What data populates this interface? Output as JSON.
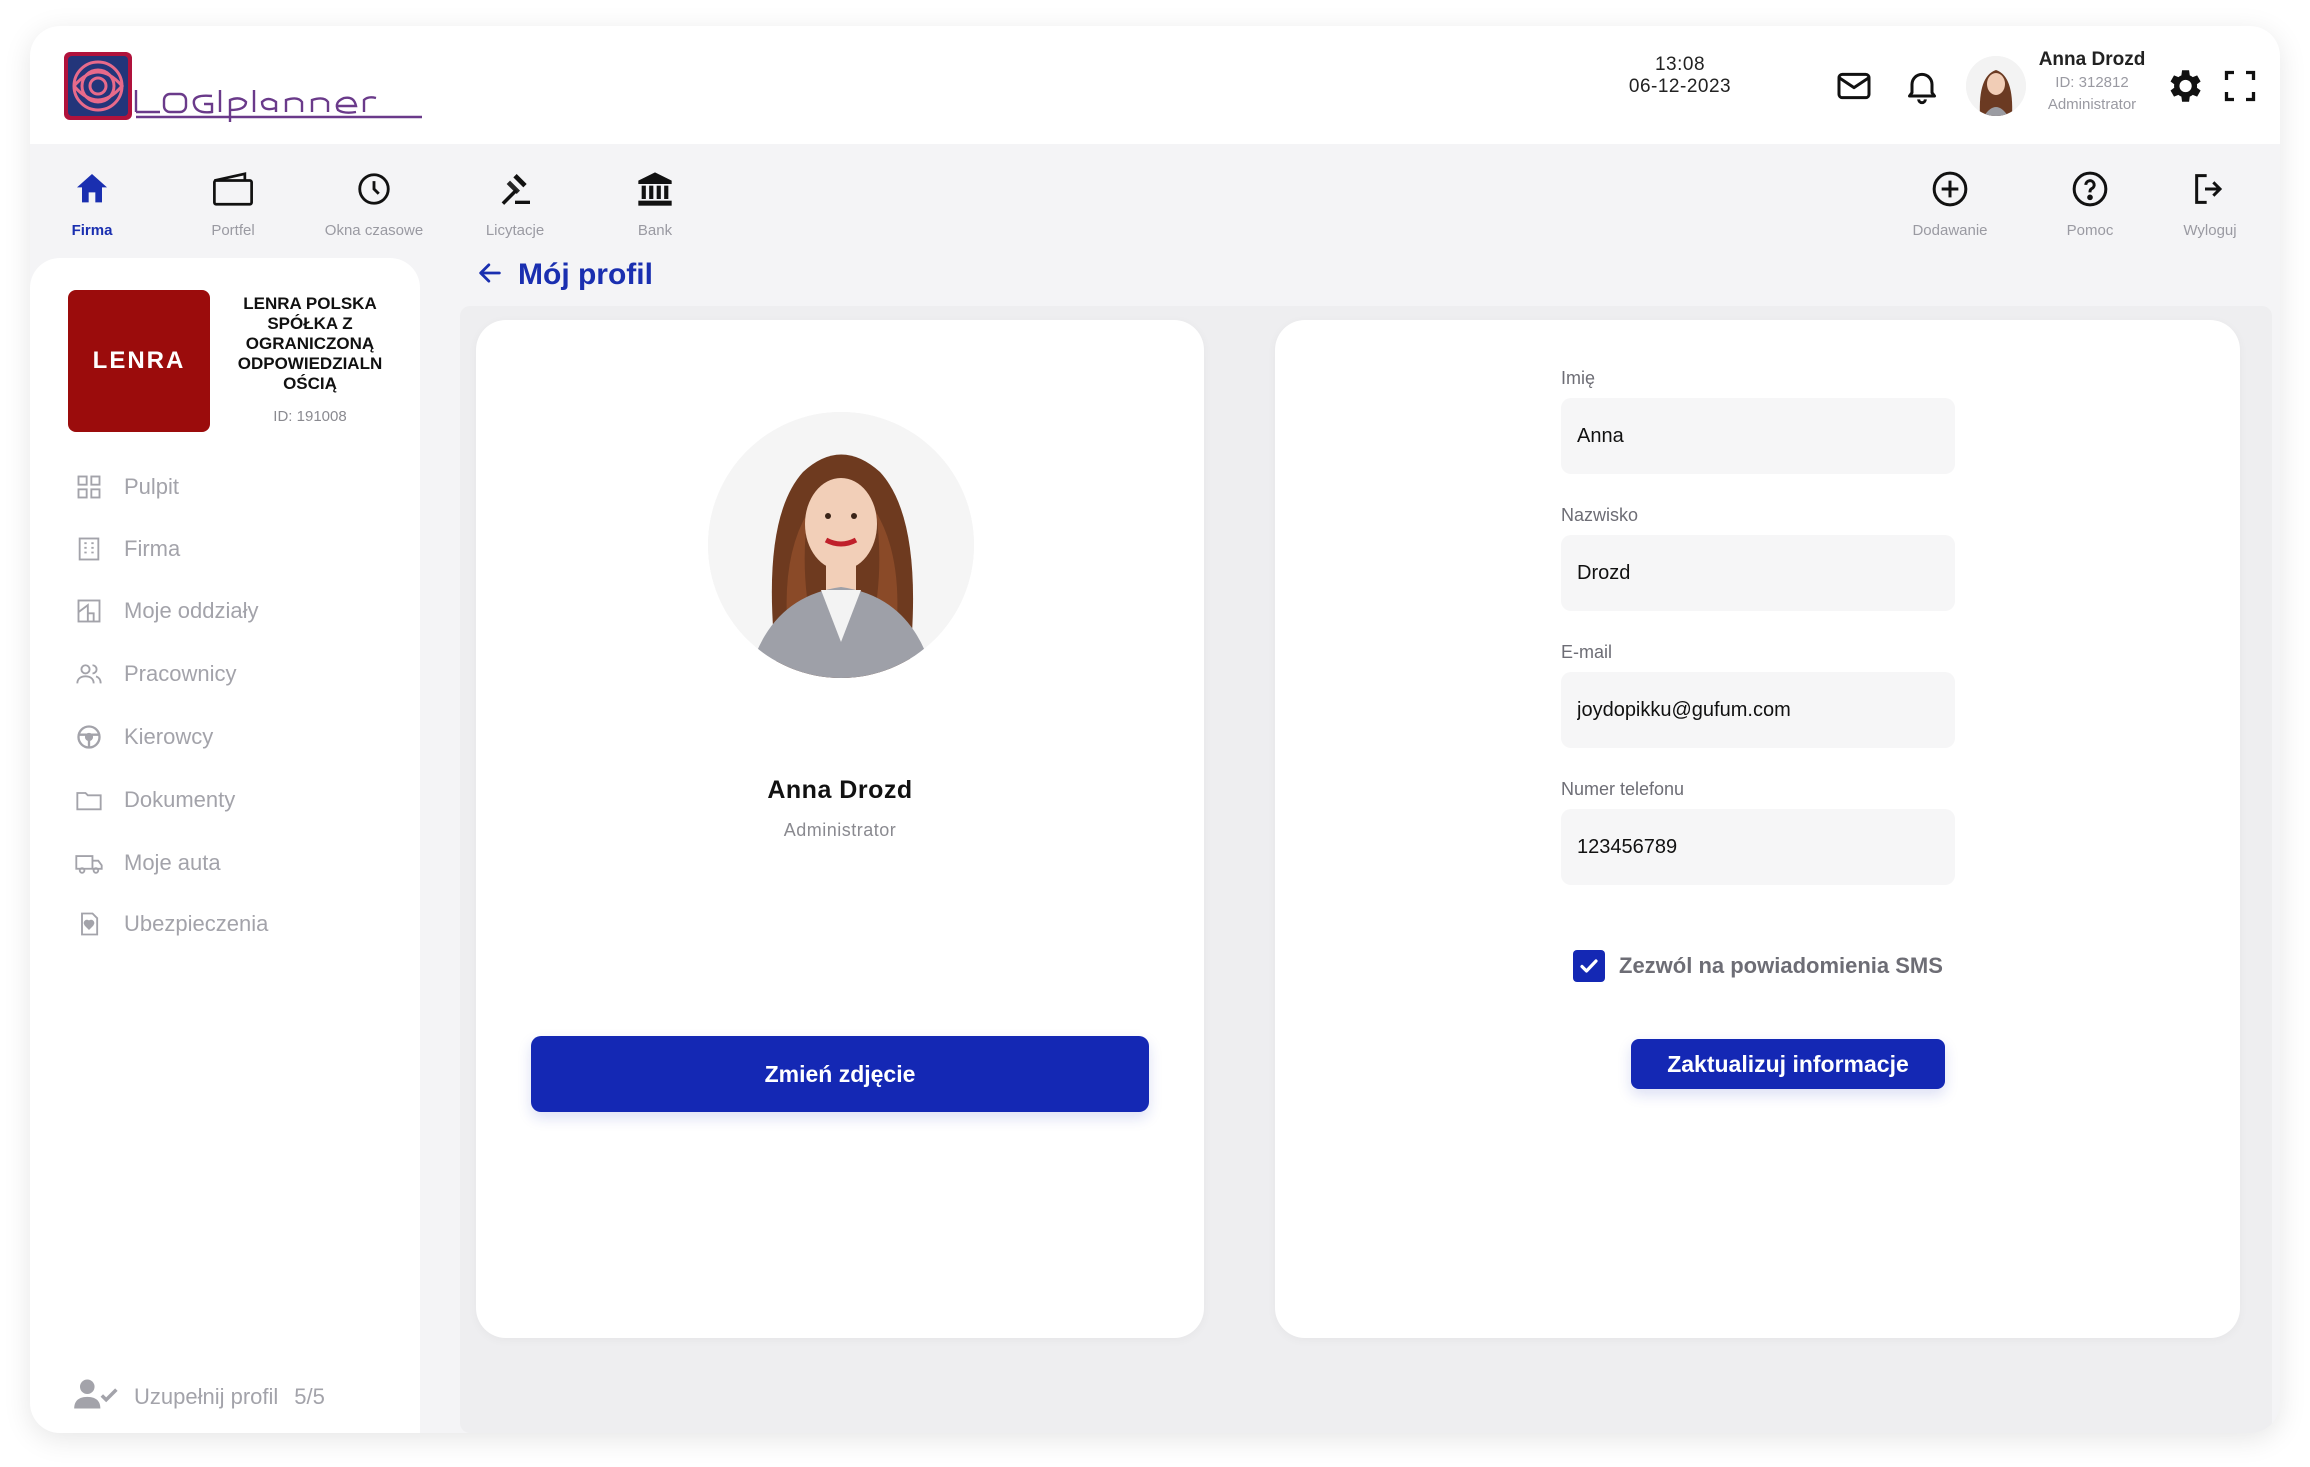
{
  "header": {
    "app_name": "LOGIplanner",
    "time": "13:08",
    "date": "06-12-2023",
    "user": {
      "name": "Anna Drozd",
      "id": "ID: 312812",
      "role": "Administrator"
    }
  },
  "toolbar": {
    "items": [
      {
        "label": "Firma",
        "icon": "home-icon",
        "active": true
      },
      {
        "label": "Portfel",
        "icon": "wallet-icon"
      },
      {
        "label": "Okna czasowe",
        "icon": "clock-icon"
      },
      {
        "label": "Licytacje",
        "icon": "gavel-icon"
      },
      {
        "label": "Bank",
        "icon": "bank-icon"
      }
    ],
    "right_items": [
      {
        "label": "Dodawanie",
        "icon": "plus-circle-icon"
      },
      {
        "label": "Pomoc",
        "icon": "help-circle-icon"
      },
      {
        "label": "Wyloguj",
        "icon": "logout-icon"
      }
    ]
  },
  "sidebar": {
    "company": {
      "logo_text": "LENRA",
      "name": "LENRA POLSKA SPÓŁKA Z OGRANICZONĄ ODPOWIEDZIALN OŚCIĄ",
      "id": "ID: 191008"
    },
    "items": [
      {
        "label": "Pulpit",
        "icon": "grid-icon"
      },
      {
        "label": "Firma",
        "icon": "building-icon"
      },
      {
        "label": "Moje oddziały",
        "icon": "branch-icon"
      },
      {
        "label": "Pracownicy",
        "icon": "users-icon"
      },
      {
        "label": "Kierowcy",
        "icon": "steering-wheel-icon"
      },
      {
        "label": "Dokumenty",
        "icon": "folder-icon"
      },
      {
        "label": "Moje auta",
        "icon": "truck-icon"
      },
      {
        "label": "Ubezpieczenia",
        "icon": "insurance-icon"
      }
    ],
    "complete_profile": {
      "label": "Uzupełnij profil",
      "progress": "5/5"
    }
  },
  "main": {
    "title": "Mój profil",
    "profile": {
      "name": "Anna Drozd",
      "role": "Administrator",
      "change_photo_label": "Zmień zdjęcie"
    },
    "form": {
      "first_name_label": "Imię",
      "first_name": "Anna",
      "last_name_label": "Nazwisko",
      "last_name": "Drozd",
      "email_label": "E-mail",
      "email": "joydopikku@gufum.com",
      "phone_label": "Numer telefonu",
      "phone": "123456789",
      "sms_label": "Zezwól na powiadomienia SMS",
      "sms_checked": true,
      "submit_label": "Zaktualizuj informacje"
    }
  },
  "colors": {
    "accent": "#1428b4",
    "brand_red": "#9b0c0c",
    "muted": "#a3a3aa"
  }
}
